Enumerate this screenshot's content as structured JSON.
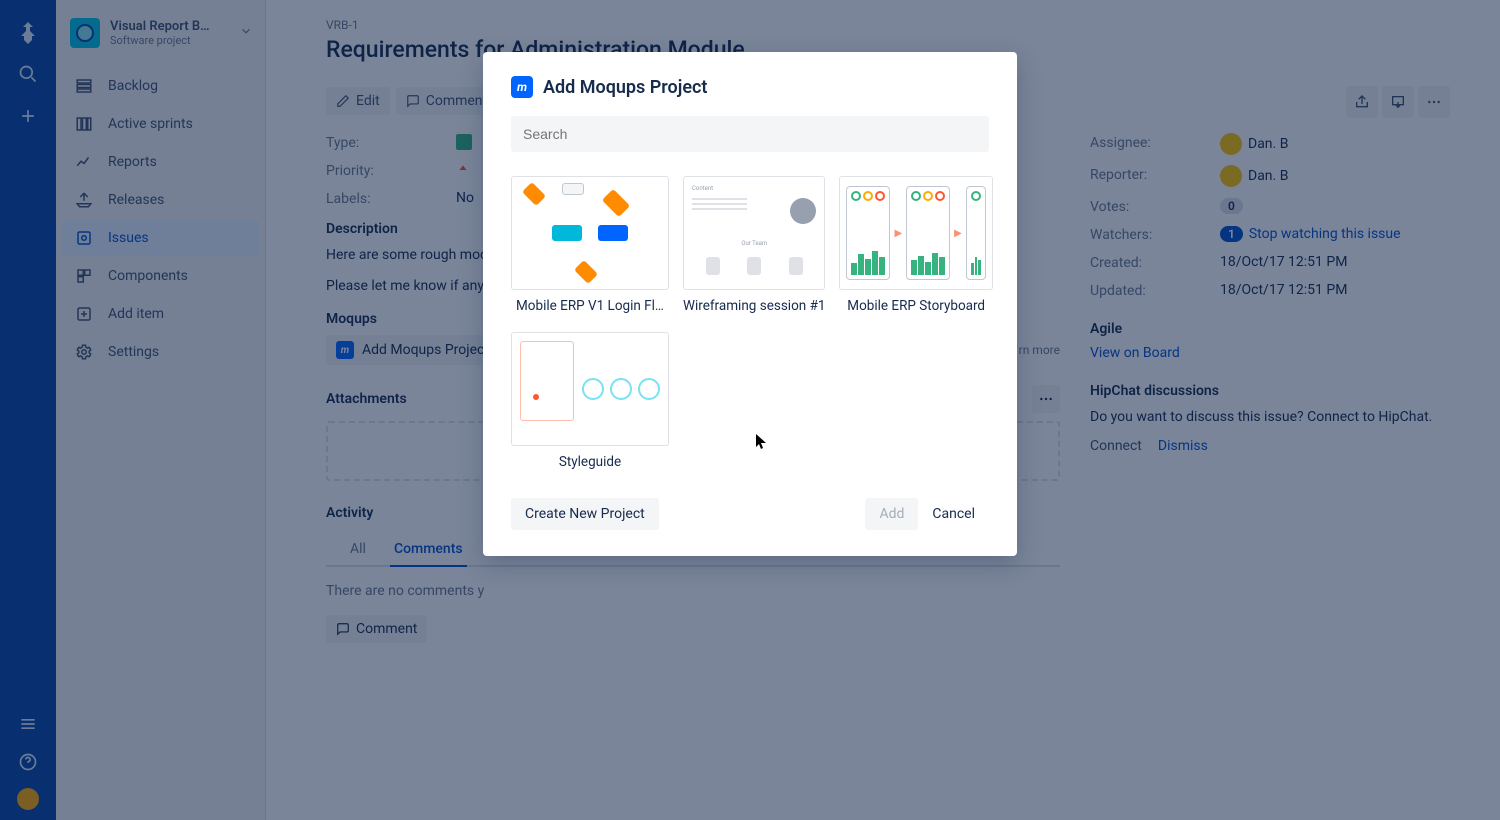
{
  "globalNav": {
    "logoTooltip": "Jira"
  },
  "project": {
    "name": "Visual Report B…",
    "type": "Software project"
  },
  "sidebar": {
    "items": [
      {
        "label": "Backlog"
      },
      {
        "label": "Active sprints"
      },
      {
        "label": "Reports"
      },
      {
        "label": "Releases"
      },
      {
        "label": "Issues"
      },
      {
        "label": "Components"
      },
      {
        "label": "Add item"
      },
      {
        "label": "Settings"
      }
    ]
  },
  "issue": {
    "key": "VRB-1",
    "summary": "Requirements for Administration Module",
    "toolbar": {
      "edit": "Edit",
      "comment": "Comment"
    },
    "fields": {
      "typeLabel": "Type:",
      "priorityLabel": "Priority:",
      "labelsLabel": "Labels:",
      "labelsValue": "No"
    },
    "descHeading": "Description",
    "descLine1": "Here are some rough mockups of the authentication flows.",
    "descLine2": "Please let me know if any",
    "moqupsHeading": "Moqups",
    "moqupsBtn": "Add Moqups Project",
    "learnMore": "rn more",
    "attachHeading": "Attachments",
    "activityHeading": "Activity",
    "tabs": {
      "all": "All",
      "comments": "Comments"
    },
    "emptyComments": "There are no comments y",
    "commentBtn": "Comment",
    "side": {
      "assigneeLabel": "Assignee:",
      "assignee": "Dan. B",
      "reporterLabel": "Reporter:",
      "reporter": "Dan. B",
      "votesLabel": "Votes:",
      "votes": "0",
      "watchersLabel": "Watchers:",
      "watchersCount": "1",
      "watchersAction": "Stop watching this issue",
      "createdLabel": "Created:",
      "created": "18/Oct/17 12:51 PM",
      "updatedLabel": "Updated:",
      "updated": "18/Oct/17 12:51 PM",
      "agileHeading": "Agile",
      "viewOnBoard": "View on Board",
      "hipchatHeading": "HipChat discussions",
      "hipchatText": "Do you want to discuss this issue? Connect to HipChat.",
      "connect": "Connect",
      "dismiss": "Dismiss"
    }
  },
  "modal": {
    "title": "Add Moqups Project",
    "searchPlaceholder": "Search",
    "projects": [
      {
        "name": "Mobile ERP V1 Login Fl…"
      },
      {
        "name": "Wireframing session #1"
      },
      {
        "name": "Mobile ERP Storyboard"
      },
      {
        "name": "Styleguide"
      }
    ],
    "createNew": "Create New Project",
    "add": "Add",
    "cancel": "Cancel"
  }
}
